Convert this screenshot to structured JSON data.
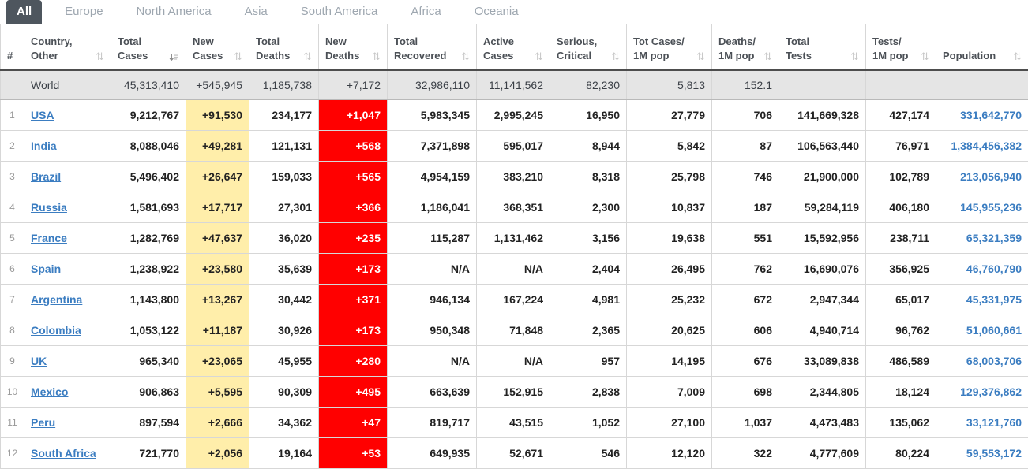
{
  "colors": {
    "highlight_yellow": "#FFEEAA",
    "highlight_red": "#FF0000",
    "link_blue": "#3B7DC1",
    "active_tab_bg": "#4E565E"
  },
  "tabs": [
    {
      "label": "All",
      "active": true
    },
    {
      "label": "Europe",
      "active": false
    },
    {
      "label": "North America",
      "active": false
    },
    {
      "label": "Asia",
      "active": false
    },
    {
      "label": "South America",
      "active": false
    },
    {
      "label": "Africa",
      "active": false
    },
    {
      "label": "Oceania",
      "active": false
    }
  ],
  "table": {
    "columns": [
      {
        "label": "#",
        "sort": "none"
      },
      {
        "label": "Country,\nOther",
        "sort": "default"
      },
      {
        "label": "Total\nCases",
        "sort": "desc"
      },
      {
        "label": "New\nCases",
        "sort": "default"
      },
      {
        "label": "Total\nDeaths",
        "sort": "default"
      },
      {
        "label": "New\nDeaths",
        "sort": "default"
      },
      {
        "label": "Total\nRecovered",
        "sort": "default"
      },
      {
        "label": "Active\nCases",
        "sort": "default"
      },
      {
        "label": "Serious,\nCritical",
        "sort": "default"
      },
      {
        "label": "Tot Cases/\n1M pop",
        "sort": "default"
      },
      {
        "label": "Deaths/\n1M pop",
        "sort": "default"
      },
      {
        "label": "Total\nTests",
        "sort": "default"
      },
      {
        "label": "Tests/\n1M pop",
        "sort": "default"
      },
      {
        "label": "Population",
        "sort": "default"
      }
    ],
    "world_row": {
      "rank": "",
      "country": "World",
      "total_cases": "45,313,410",
      "new_cases": "+545,945",
      "total_deaths": "1,185,738",
      "new_deaths": "+7,172",
      "total_recovered": "32,986,110",
      "active_cases": "11,141,562",
      "serious_critical": "82,230",
      "tot_cases_1m": "5,813",
      "deaths_1m": "152.1",
      "total_tests": "",
      "tests_1m": "",
      "population": ""
    },
    "rows": [
      {
        "rank": "1",
        "country": "USA",
        "total_cases": "9,212,767",
        "new_cases": "+91,530",
        "total_deaths": "234,177",
        "new_deaths": "+1,047",
        "total_recovered": "5,983,345",
        "active_cases": "2,995,245",
        "serious_critical": "16,950",
        "tot_cases_1m": "27,779",
        "deaths_1m": "706",
        "total_tests": "141,669,328",
        "tests_1m": "427,174",
        "population": "331,642,770"
      },
      {
        "rank": "2",
        "country": "India",
        "total_cases": "8,088,046",
        "new_cases": "+49,281",
        "total_deaths": "121,131",
        "new_deaths": "+568",
        "total_recovered": "7,371,898",
        "active_cases": "595,017",
        "serious_critical": "8,944",
        "tot_cases_1m": "5,842",
        "deaths_1m": "87",
        "total_tests": "106,563,440",
        "tests_1m": "76,971",
        "population": "1,384,456,382"
      },
      {
        "rank": "3",
        "country": "Brazil",
        "total_cases": "5,496,402",
        "new_cases": "+26,647",
        "total_deaths": "159,033",
        "new_deaths": "+565",
        "total_recovered": "4,954,159",
        "active_cases": "383,210",
        "serious_critical": "8,318",
        "tot_cases_1m": "25,798",
        "deaths_1m": "746",
        "total_tests": "21,900,000",
        "tests_1m": "102,789",
        "population": "213,056,940"
      },
      {
        "rank": "4",
        "country": "Russia",
        "total_cases": "1,581,693",
        "new_cases": "+17,717",
        "total_deaths": "27,301",
        "new_deaths": "+366",
        "total_recovered": "1,186,041",
        "active_cases": "368,351",
        "serious_critical": "2,300",
        "tot_cases_1m": "10,837",
        "deaths_1m": "187",
        "total_tests": "59,284,119",
        "tests_1m": "406,180",
        "population": "145,955,236"
      },
      {
        "rank": "5",
        "country": "France",
        "total_cases": "1,282,769",
        "new_cases": "+47,637",
        "total_deaths": "36,020",
        "new_deaths": "+235",
        "total_recovered": "115,287",
        "active_cases": "1,131,462",
        "serious_critical": "3,156",
        "tot_cases_1m": "19,638",
        "deaths_1m": "551",
        "total_tests": "15,592,956",
        "tests_1m": "238,711",
        "population": "65,321,359"
      },
      {
        "rank": "6",
        "country": "Spain",
        "total_cases": "1,238,922",
        "new_cases": "+23,580",
        "total_deaths": "35,639",
        "new_deaths": "+173",
        "total_recovered": "N/A",
        "active_cases": "N/A",
        "serious_critical": "2,404",
        "tot_cases_1m": "26,495",
        "deaths_1m": "762",
        "total_tests": "16,690,076",
        "tests_1m": "356,925",
        "population": "46,760,790"
      },
      {
        "rank": "7",
        "country": "Argentina",
        "total_cases": "1,143,800",
        "new_cases": "+13,267",
        "total_deaths": "30,442",
        "new_deaths": "+371",
        "total_recovered": "946,134",
        "active_cases": "167,224",
        "serious_critical": "4,981",
        "tot_cases_1m": "25,232",
        "deaths_1m": "672",
        "total_tests": "2,947,344",
        "tests_1m": "65,017",
        "population": "45,331,975"
      },
      {
        "rank": "8",
        "country": "Colombia",
        "total_cases": "1,053,122",
        "new_cases": "+11,187",
        "total_deaths": "30,926",
        "new_deaths": "+173",
        "total_recovered": "950,348",
        "active_cases": "71,848",
        "serious_critical": "2,365",
        "tot_cases_1m": "20,625",
        "deaths_1m": "606",
        "total_tests": "4,940,714",
        "tests_1m": "96,762",
        "population": "51,060,661"
      },
      {
        "rank": "9",
        "country": "UK",
        "total_cases": "965,340",
        "new_cases": "+23,065",
        "total_deaths": "45,955",
        "new_deaths": "+280",
        "total_recovered": "N/A",
        "active_cases": "N/A",
        "serious_critical": "957",
        "tot_cases_1m": "14,195",
        "deaths_1m": "676",
        "total_tests": "33,089,838",
        "tests_1m": "486,589",
        "population": "68,003,706"
      },
      {
        "rank": "10",
        "country": "Mexico",
        "total_cases": "906,863",
        "new_cases": "+5,595",
        "total_deaths": "90,309",
        "new_deaths": "+495",
        "total_recovered": "663,639",
        "active_cases": "152,915",
        "serious_critical": "2,838",
        "tot_cases_1m": "7,009",
        "deaths_1m": "698",
        "total_tests": "2,344,805",
        "tests_1m": "18,124",
        "population": "129,376,862"
      },
      {
        "rank": "11",
        "country": "Peru",
        "total_cases": "897,594",
        "new_cases": "+2,666",
        "total_deaths": "34,362",
        "new_deaths": "+47",
        "total_recovered": "819,717",
        "active_cases": "43,515",
        "serious_critical": "1,052",
        "tot_cases_1m": "27,100",
        "deaths_1m": "1,037",
        "total_tests": "4,473,483",
        "tests_1m": "135,062",
        "population": "33,121,760"
      },
      {
        "rank": "12",
        "country": "South Africa",
        "total_cases": "721,770",
        "new_cases": "+2,056",
        "total_deaths": "19,164",
        "new_deaths": "+53",
        "total_recovered": "649,935",
        "active_cases": "52,671",
        "serious_critical": "546",
        "tot_cases_1m": "12,120",
        "deaths_1m": "322",
        "total_tests": "4,777,609",
        "tests_1m": "80,224",
        "population": "59,553,172"
      }
    ]
  }
}
